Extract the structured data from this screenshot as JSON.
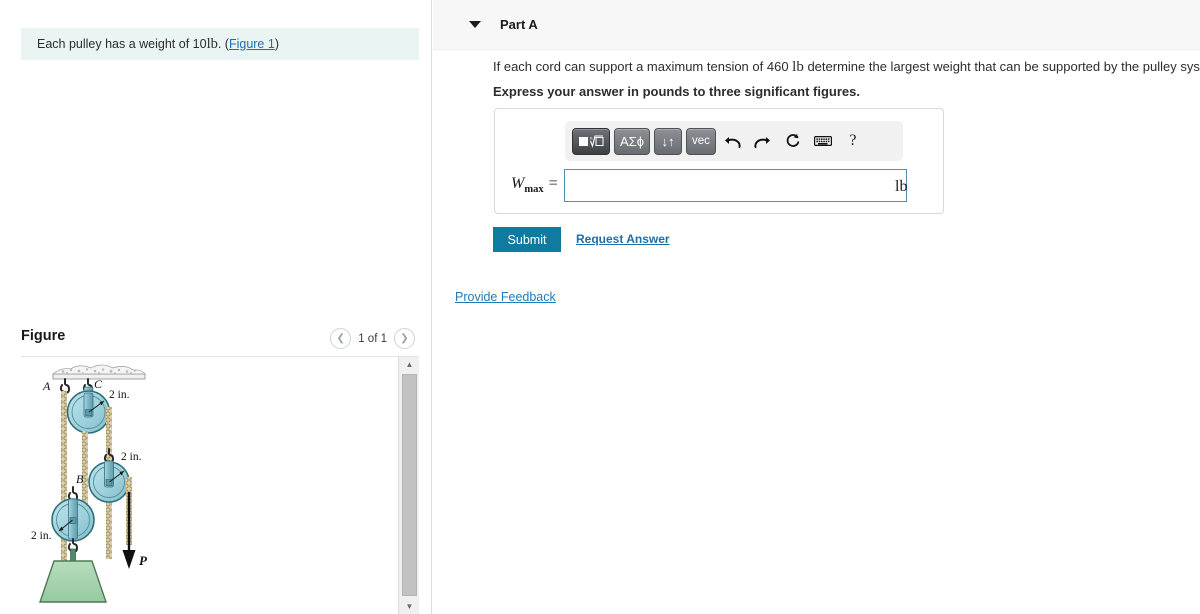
{
  "hint": {
    "text_before": "Each pulley has a weight of 10 ",
    "unit": "lb",
    "text_after": ". (",
    "figure_link": "Figure 1",
    "text_end": ")"
  },
  "figure_panel": {
    "title": "Figure",
    "page_label": "1 of 1",
    "prev_icon": "chevron-left-icon",
    "next_icon": "chevron-right-icon",
    "scroll_up_icon": "triangle-up-icon",
    "scroll_down_icon": "triangle-down-icon",
    "diagram": {
      "labels": {
        "point_a": "A",
        "point_b": "B",
        "point_c": "C",
        "radius_top": "2 in.",
        "radius_mid": "2 in.",
        "radius_bottom": "2 in.",
        "force": "P"
      },
      "colors": {
        "pulley_fill": "#9fd2dd",
        "pulley_stroke": "#2f6f7c",
        "block_fill": "#a9d4b0",
        "block_stroke": "#4d7a55",
        "rope": "#d9cda4",
        "rope_stroke": "#8f7f52",
        "ceiling": "#e9e9e9"
      }
    }
  },
  "part": {
    "caret_icon": "chevron-down-icon",
    "title": "Part A",
    "question_pre": "If each cord can support a maximum tension of 460 ",
    "question_unit": "lb",
    "question_post": " determine the largest weight that can be supported by the pulley system.",
    "instruction": "Express your answer in pounds to three significant figures."
  },
  "math_toolbar": {
    "buttons": [
      {
        "name": "template-sqrt-button",
        "label": "■√□",
        "icon": "square-root-template-icon"
      },
      {
        "name": "greek-symbols-button",
        "label": "ΑΣϕ",
        "icon": "greek-letters-icon"
      },
      {
        "name": "sort-updown-button",
        "label": "↓↑",
        "icon": "arrows-updown-icon"
      },
      {
        "name": "vector-button",
        "label": "vec",
        "icon": "vector-icon"
      }
    ],
    "actions": [
      {
        "name": "undo-button",
        "icon": "undo-arrow-icon"
      },
      {
        "name": "redo-button",
        "icon": "redo-arrow-icon"
      },
      {
        "name": "reset-button",
        "icon": "refresh-circle-icon"
      },
      {
        "name": "keyboard-button",
        "icon": "keyboard-icon"
      },
      {
        "name": "help-button",
        "icon": "question-mark-icon",
        "label": "?"
      }
    ]
  },
  "answer": {
    "variable": "W",
    "subscript": "max",
    "equals": "=",
    "value": "",
    "placeholder": "",
    "unit": "lb"
  },
  "actions": {
    "submit_label": "Submit",
    "request_answer_label": "Request Answer",
    "provide_feedback_label": "Provide Feedback"
  },
  "colors": {
    "accent": "#0f7ba0",
    "link": "#1e6fa8",
    "hint_bg": "#e9f4f3",
    "input_border": "#4d8fb0"
  }
}
